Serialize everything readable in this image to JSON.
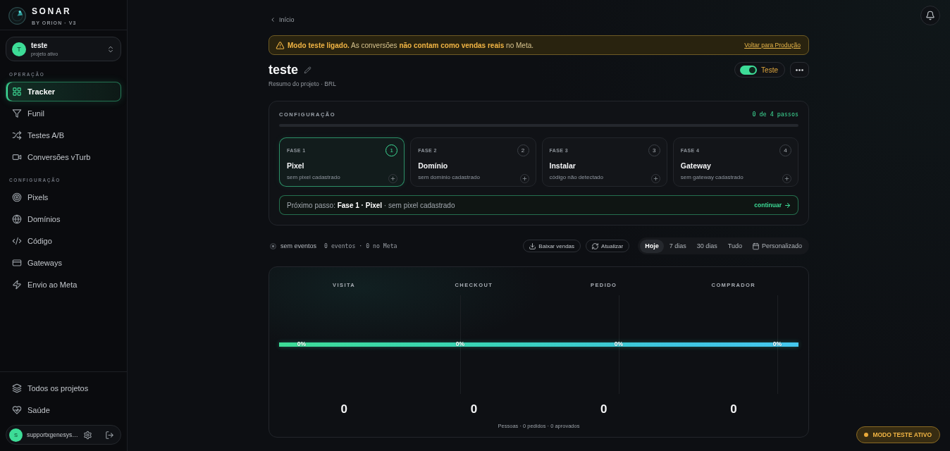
{
  "app": {
    "name": "SONAR",
    "tagline": "BY ORION · V3"
  },
  "project_switcher": {
    "avatar": "T",
    "name": "teste",
    "caption": "projeto ativo"
  },
  "sidebar": {
    "sections": [
      {
        "heading": "OPERAÇÃO",
        "items": [
          {
            "label": "Tracker",
            "selected": true
          },
          {
            "label": "Funil",
            "selected": false
          },
          {
            "label": "Testes A/B",
            "selected": false
          },
          {
            "label": "Conversões vTurb",
            "selected": false
          }
        ]
      },
      {
        "heading": "CONFIGURAÇÃO",
        "items": [
          {
            "label": "Pixels",
            "selected": false
          },
          {
            "label": "Domínios",
            "selected": false
          },
          {
            "label": "Código",
            "selected": false
          },
          {
            "label": "Gateways",
            "selected": false
          },
          {
            "label": "Envio ao Meta",
            "selected": false
          }
        ]
      }
    ],
    "footer_items": [
      {
        "label": "Todos os projetos",
        "selected": false
      },
      {
        "label": "Saúde",
        "selected": false
      }
    ]
  },
  "user": {
    "avatar": "S",
    "email": "supportxgenesys…"
  },
  "breadcrumb": {
    "back": "Início"
  },
  "banner": {
    "message": "**Modo teste ligado.** As conversões **não contam como vendas reais** no Meta.",
    "action": "Voltar para Produção"
  },
  "header": {
    "title": "teste",
    "subtitle": "Resumo do projeto · BRL",
    "mode_toggle": {
      "label": "Teste",
      "on": true
    }
  },
  "setup": {
    "heading": "CONFIGURAÇÃO",
    "progress": "0 de 4 passos",
    "level": 0,
    "phases": [
      {
        "label": "FASE 1",
        "number": "1",
        "title": "Pixel",
        "status": "sem pixel cadastrado",
        "selected": true
      },
      {
        "label": "FASE 2",
        "number": "2",
        "title": "Domínio",
        "status": "sem domínio cadastrado",
        "selected": false
      },
      {
        "label": "FASE 3",
        "number": "3",
        "title": "Instalar",
        "status": "código não detectado",
        "selected": false
      },
      {
        "label": "FASE 4",
        "number": "4",
        "title": "Gateway",
        "status": "sem gateway cadastrado",
        "selected": false
      }
    ],
    "next_step": {
      "text": "Próximo passo: **Fase 1 · Pixel** · sem pixel cadastrado",
      "action": "continuar"
    }
  },
  "events": {
    "status": "sem eventos",
    "counts": "0 eventos · 0 no Meta",
    "actions": [
      "Baixar vendas",
      "Atualizar"
    ],
    "ranges": [
      {
        "label": "Hoje",
        "selected": true
      },
      {
        "label": "7 dias",
        "selected": false
      },
      {
        "label": "30 dias",
        "selected": false
      },
      {
        "label": "Tudo",
        "selected": false
      },
      {
        "label": "Personalizado",
        "selected": false
      }
    ]
  },
  "funnel": {
    "stages": [
      {
        "label": "VISITA",
        "percent": "0%",
        "count": "0"
      },
      {
        "label": "CHECKOUT",
        "percent": "0%",
        "count": "0"
      },
      {
        "label": "PEDIDO",
        "percent": "0%",
        "count": "0"
      },
      {
        "label": "COMPRADOR",
        "percent": "0%",
        "count": "0"
      }
    ],
    "caption": "Pessoas · 0 pedidos · 0 aprovados"
  },
  "status_badge": "MODO TESTE ATIVO"
}
